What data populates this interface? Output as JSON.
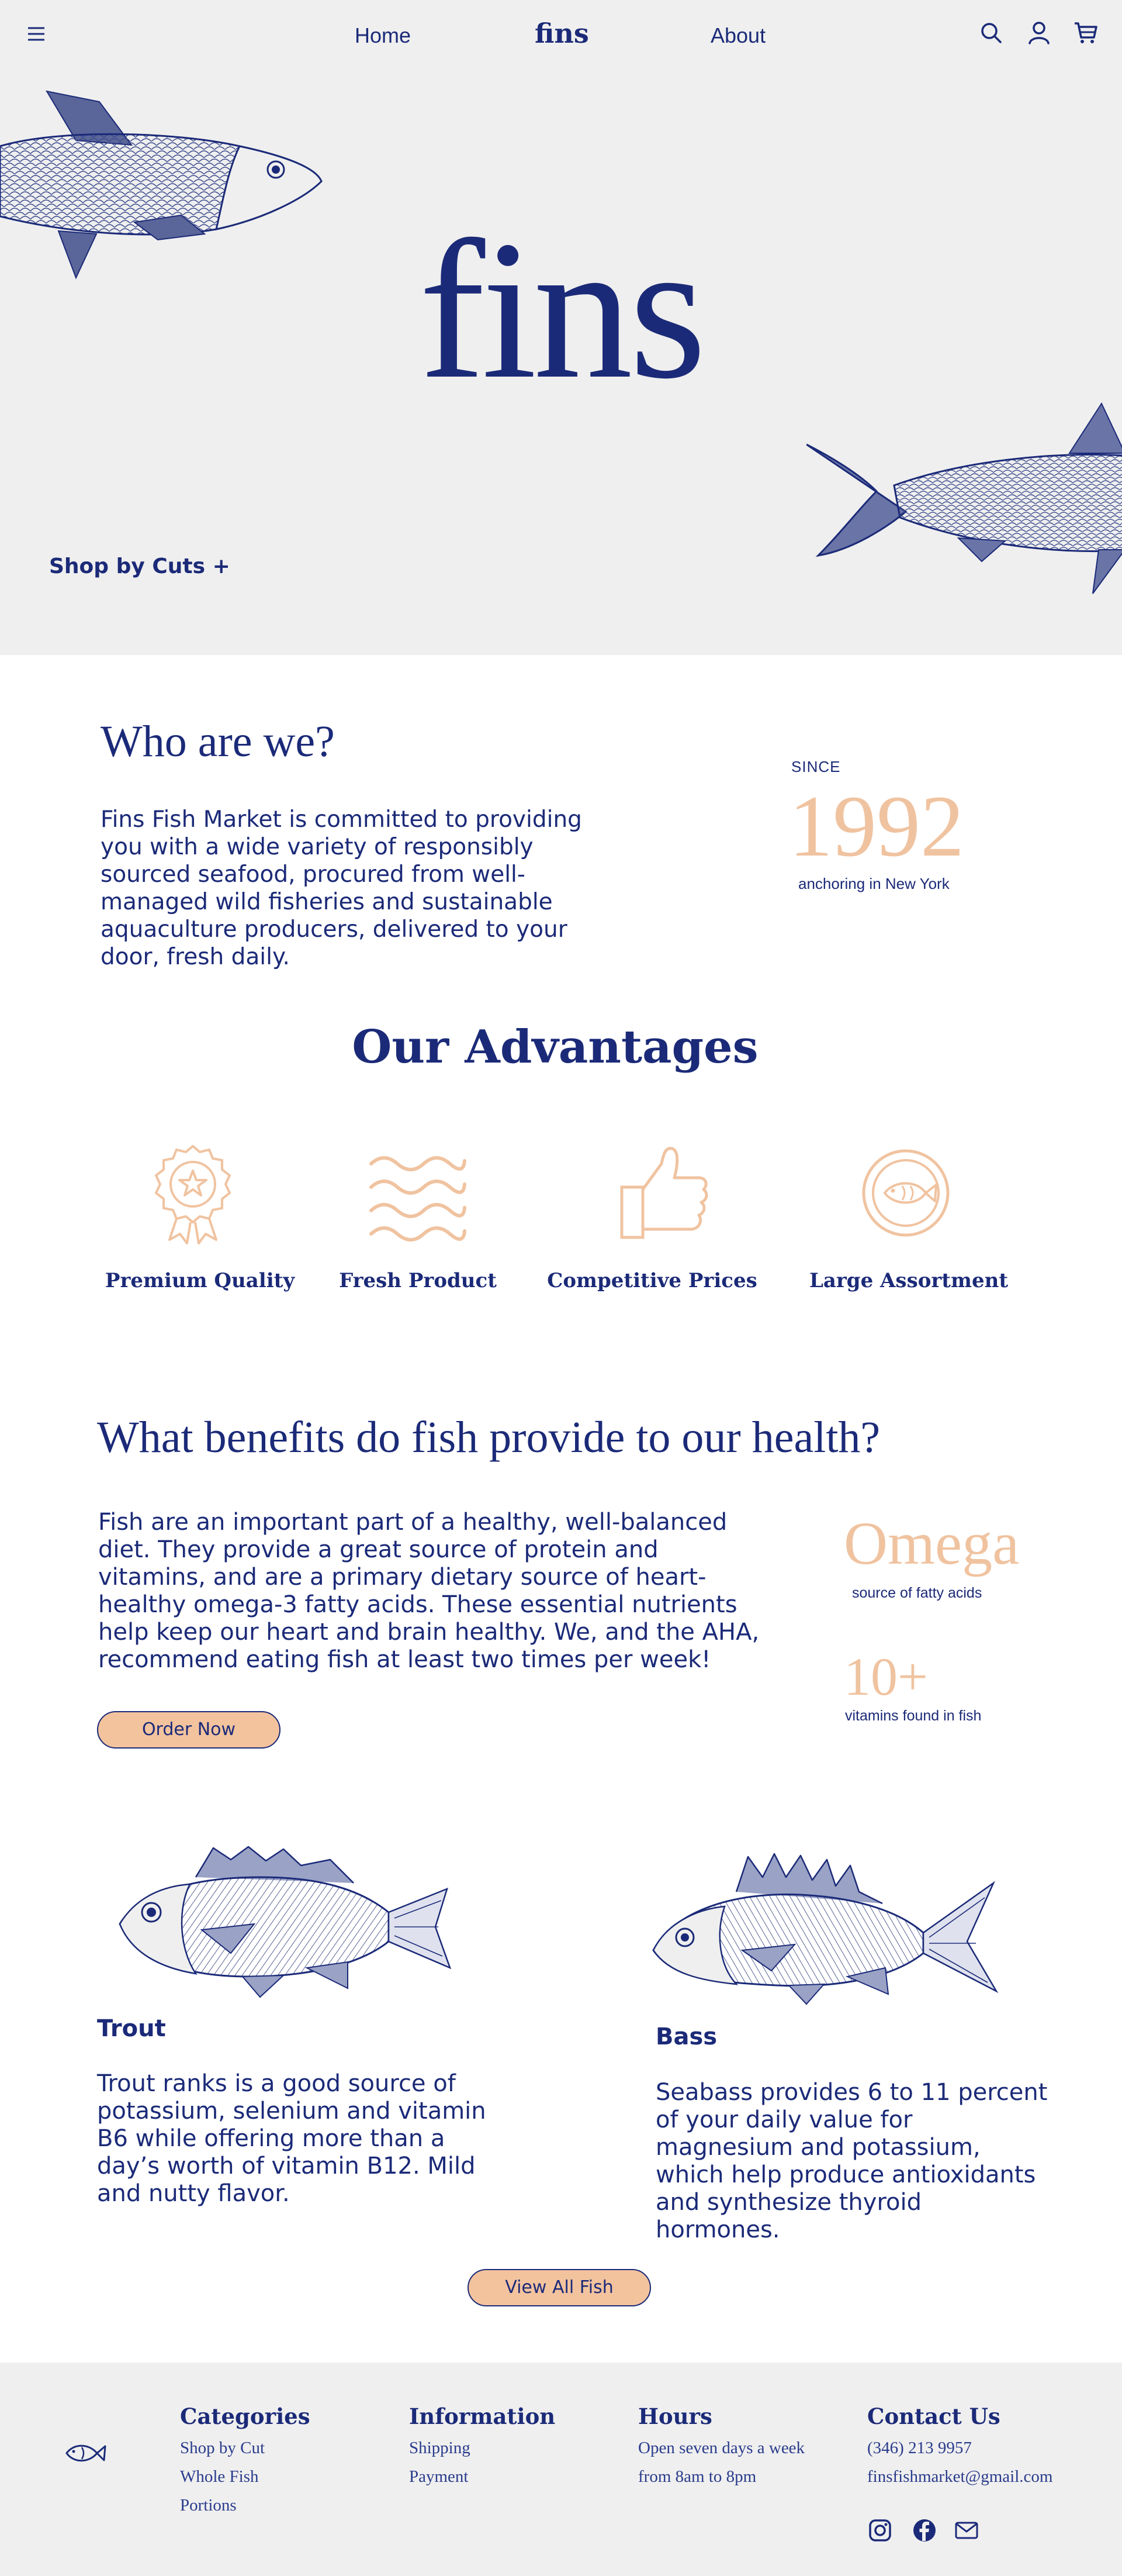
{
  "nav": {
    "home": "Home",
    "logo": "fins",
    "about": "About",
    "icons": [
      "menu-icon",
      "search-icon",
      "account-icon",
      "cart-icon"
    ]
  },
  "hero": {
    "title": "fins",
    "shop_by_cuts": "Shop by Cuts +"
  },
  "who": {
    "title": "Who are we?",
    "body": "Fins Fish Market is committed to providing you with a wide variety of responsibly sourced seafood, procured from well-managed wild fisheries and sustainable aquaculture producers, delivered to your door, fresh daily.",
    "since_label": "SINCE",
    "since_year": "1992",
    "since_sub": "anchoring in New York"
  },
  "advantages": {
    "title": "Our Advantages",
    "items": [
      {
        "label": "Premium Quality",
        "icon": "award-ribbon-icon"
      },
      {
        "label": "Fresh Product",
        "icon": "waves-icon"
      },
      {
        "label": "Competitive Prices",
        "icon": "thumbs-up-icon"
      },
      {
        "label": "Large Assortment",
        "icon": "fish-badge-icon"
      }
    ]
  },
  "benefits": {
    "title": "What benefits do fish provide to our health?",
    "body": "Fish are an important part of a healthy, well-balanced diet. They provide a great source of protein and vitamins, and are a primary dietary source of heart-healthy omega-3 fatty acids. These essential nutrients help keep our heart and brain healthy. We, and the AHA, recommend eating fish at least two times per week!",
    "order_button": "Order Now",
    "stat1_value": "Omega",
    "stat1_label": "source of fatty acids",
    "stat2_value": "10+",
    "stat2_label": "vitamins found in fish"
  },
  "fish": [
    {
      "name": "Trout",
      "desc": "Trout ranks is a good source of potassium, selenium and vitamin B6 while offering more than a day’s worth of vitamin B12. Mild and nutty flavor."
    },
    {
      "name": "Bass",
      "desc": "Seabass provides 6 to 11 percent of your daily value for magnesium and potassium, which help produce antioxidants and synthesize thyroid hormones."
    }
  ],
  "view_all": "View All Fish",
  "footer": {
    "categories": {
      "title": "Categories",
      "items": [
        "Shop by Cut",
        "Whole Fish",
        "Portions"
      ]
    },
    "information": {
      "title": "Information",
      "items": [
        "Shipping",
        "Payment"
      ]
    },
    "hours": {
      "title": "Hours",
      "items": [
        "Open seven days a week",
        "from 8am to 8pm"
      ]
    },
    "contact": {
      "title": "Contact Us",
      "phone": "(346) 213 9957",
      "email": "finsfishmarket@gmail.com"
    },
    "social_icons": [
      "instagram-icon",
      "facebook-icon",
      "mail-icon"
    ]
  },
  "colors": {
    "navy": "#1b2a78",
    "peach": "#f0c3a0",
    "hero_bg": "#efefef"
  }
}
